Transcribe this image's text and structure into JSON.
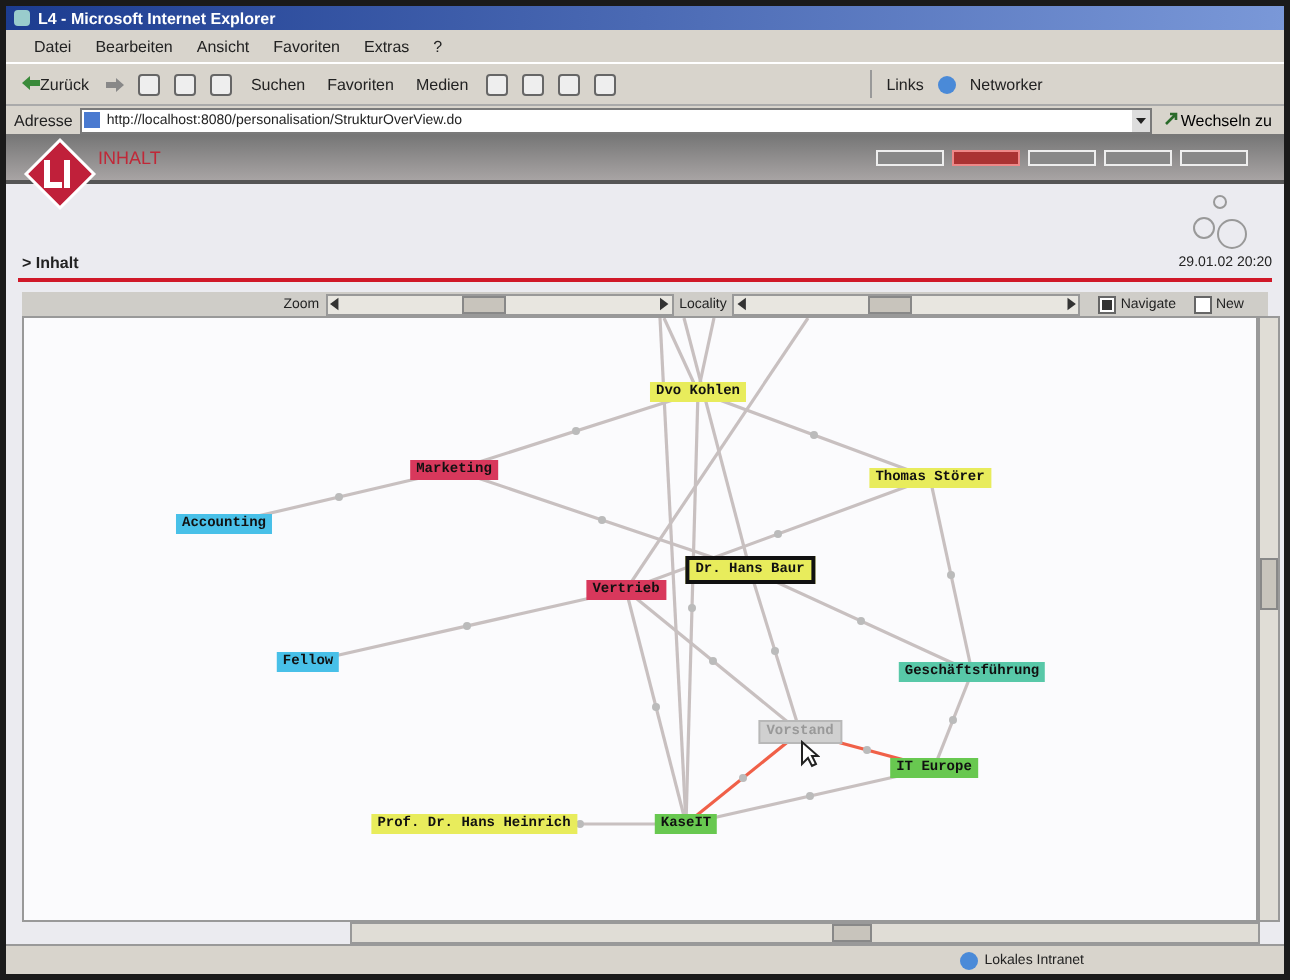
{
  "window": {
    "title": "L4 - Microsoft Internet Explorer"
  },
  "menu": [
    "Datei",
    "Bearbeiten",
    "Ansicht",
    "Favoriten",
    "Extras",
    "?"
  ],
  "toolbar": {
    "back": "Zurück",
    "search": "Suchen",
    "favorites": "Favoriten",
    "media": "Medien",
    "links": "Links",
    "networker": "Networker"
  },
  "address": {
    "label": "Adresse",
    "url": "http://localhost:8080/personalisation/StrukturOverView.do",
    "go": "Wechseln zu"
  },
  "page": {
    "section": "INHALT",
    "nav_buttons": [
      {
        "selected": false
      },
      {
        "selected": true
      },
      {
        "selected": false
      },
      {
        "selected": false
      },
      {
        "selected": false
      }
    ],
    "breadcrumb": "> Inhalt",
    "timestamp": "29.01.02 20:20"
  },
  "controls": {
    "sliders": [
      {
        "label": "Zoom",
        "level": 0.45
      },
      {
        "label": "Locality",
        "level": 0.45
      }
    ],
    "options": [
      {
        "label": "Navigate",
        "checked": true
      },
      {
        "label": "New",
        "checked": false
      }
    ]
  },
  "graph": {
    "nodes": [
      {
        "label": "Dvo Kohlen",
        "color": "#e8ec5c",
        "kind": "normal",
        "hovered": false
      },
      {
        "label": "Marketing",
        "color": "#d8385c",
        "kind": "normal",
        "hovered": false
      },
      {
        "label": "Accounting",
        "color": "#48c0e8",
        "kind": "normal",
        "hovered": false
      },
      {
        "label": "Thomas Störer",
        "color": "#e8ec5c",
        "kind": "normal",
        "hovered": false
      },
      {
        "label": "Dr. Hans Baur",
        "color": "#e8ec5c",
        "kind": "focus",
        "hovered": false
      },
      {
        "label": "Vertrieb",
        "color": "#d8385c",
        "kind": "normal",
        "hovered": false
      },
      {
        "label": "Fellow",
        "color": "#48c0e8",
        "kind": "normal",
        "hovered": false
      },
      {
        "label": "Geschäftsführung",
        "color": "#58c8a8",
        "kind": "normal",
        "hovered": false
      },
      {
        "label": "Vorstand",
        "color": "#d0d0d0",
        "kind": "dimmed",
        "hovered": true
      },
      {
        "label": "IT Europe",
        "color": "#68c850",
        "kind": "normal",
        "hovered": false
      },
      {
        "label": "KaseIT",
        "color": "#68c850",
        "kind": "normal",
        "hovered": false
      },
      {
        "label": "Prof. Dr. Hans Heinrich",
        "color": "#e8ec5c",
        "kind": "normal",
        "hovered": false
      }
    ]
  },
  "status_bar": {
    "zone": "Lokales Intranet"
  }
}
